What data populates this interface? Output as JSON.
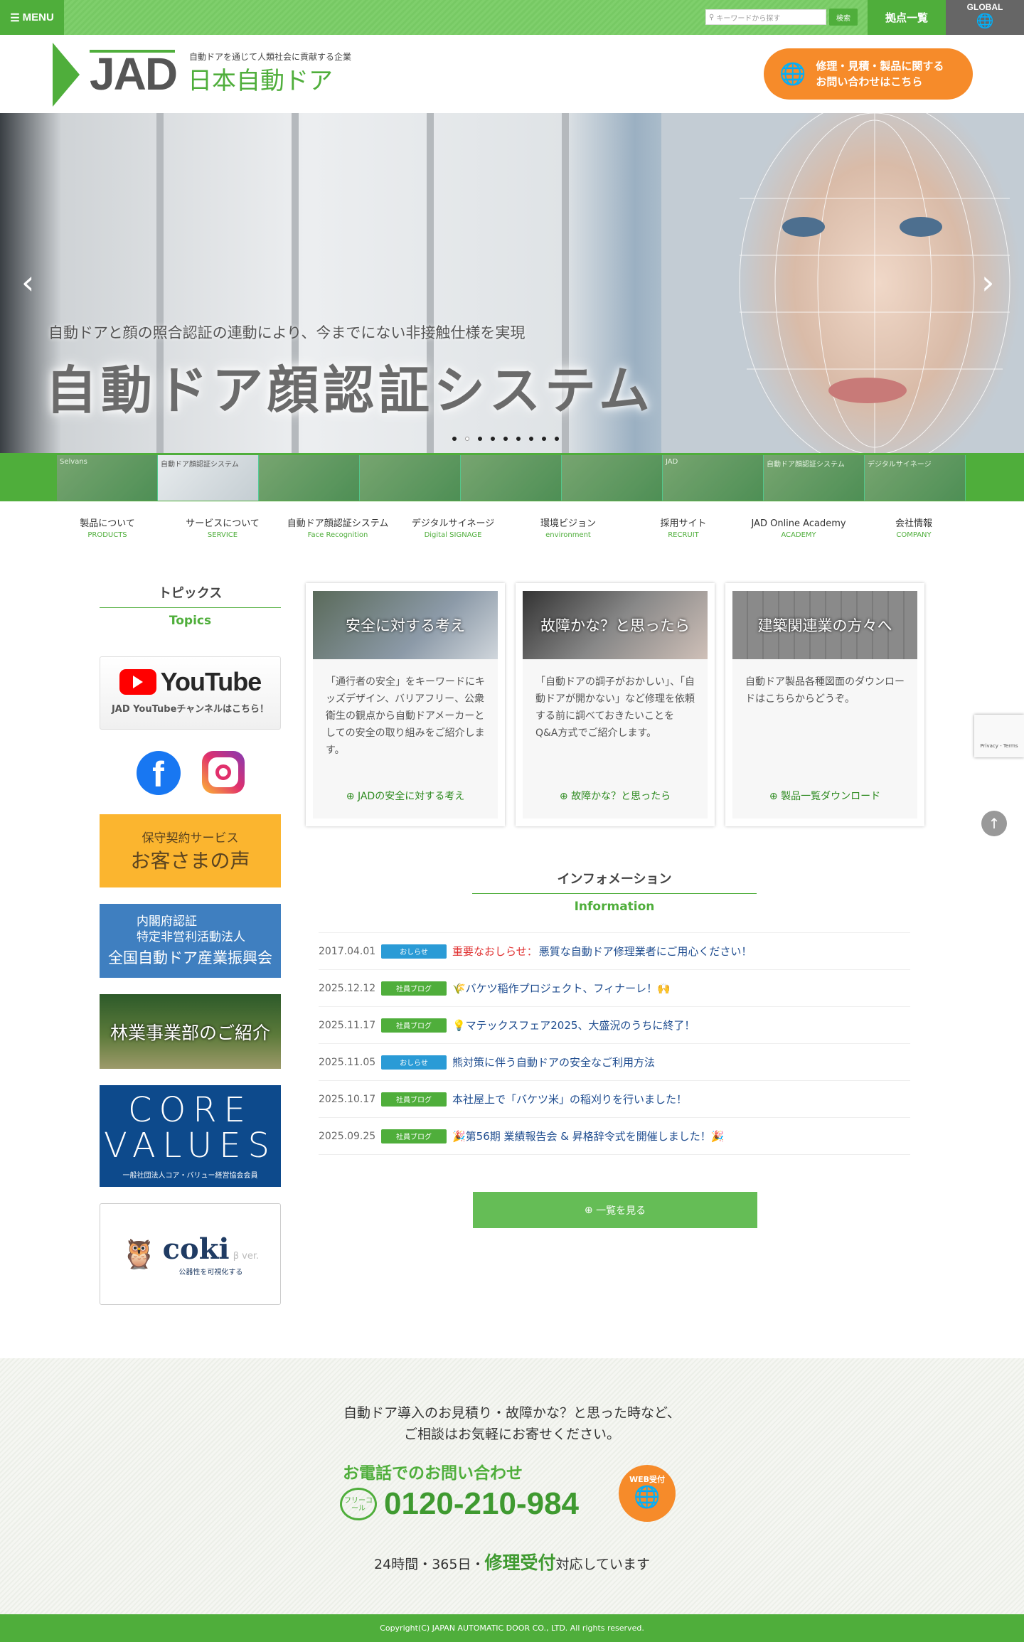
{
  "topbar": {
    "menu": "MENU",
    "search_placeholder": "キーワードから探す",
    "search_button": "検索",
    "bases": "拠点一覧",
    "global": "GLOBAL"
  },
  "header": {
    "logo": "JAD",
    "tagline": "自動ドアを通じて人類社会に貢献する企業",
    "company": "日本自動ドア",
    "cta_line1": "修理・見積・製品に関する",
    "cta_line2": "お問い合わせはこちら"
  },
  "hero": {
    "subtitle": "自動ドアと顔の照合認証の連動により、今までにない非接触仕様を実現",
    "title": "自動ドア顔認証システム",
    "slide_count": 9,
    "active_slide": 2
  },
  "thumbnails": [
    "Selvans",
    "自動ドア顔認証システム",
    "",
    "",
    "",
    "",
    "JAD",
    "自動ドア顔認証システム",
    "デジタルサイネージ"
  ],
  "nav": [
    {
      "ja": "製品について",
      "en": "PRODUCTS"
    },
    {
      "ja": "サービスについて",
      "en": "SERVICE"
    },
    {
      "ja": "自動ドア顔認証システム",
      "en": "Face Recognition"
    },
    {
      "ja": "デジタルサイネージ",
      "en": "Digital SIGNAGE"
    },
    {
      "ja": "環境ビジョン",
      "en": "environment"
    },
    {
      "ja": "採用サイト",
      "en": "RECRUIT"
    },
    {
      "ja": "JAD Online Academy",
      "en": "ACADEMY"
    },
    {
      "ja": "会社情報",
      "en": "COMPANY"
    }
  ],
  "topics": {
    "title": "トピックス",
    "subtitle": "Topics",
    "youtube": {
      "logo": "YouTube",
      "caption": "JAD YouTubeチャンネルはこちら！"
    },
    "voice": {
      "small": "保守契約サービス",
      "large": "お客さまの声"
    },
    "jadia": {
      "line1": "内閣府認証",
      "line2": "特定非営利活動法人",
      "line3": "全国自動ドア産業振興会"
    },
    "forestry": "林業事業部のご紹介",
    "core": {
      "line1": "CORE",
      "line2": "VALUES",
      "caption": "一般社団法人コア・バリュー経営協会会員"
    },
    "coki": {
      "logo": "coki",
      "beta": "β ver.",
      "caption": "公器性を可視化する"
    }
  },
  "cards": [
    {
      "title": "安全に対する考え",
      "text": "「通行者の安全」をキーワードにキッズデザイン、バリアフリー、公衆衛生の観点から自動ドアメーカーとしての安全の取り組みをご紹介します。",
      "link": "JADの安全に対する考え"
    },
    {
      "title": "故障かな？と思ったら",
      "text": "「自動ドアの調子がおかしい」、「自動ドアが開かない」など修理を依頼する前に調べておきたいことをQ&A方式でご紹介します。",
      "link": "故障かな？と思ったら"
    },
    {
      "title": "建築関連業の方々へ",
      "text": "自動ドア製品各種図面のダウンロードはこちらからどうぞ。",
      "link": "製品一覧ダウンロード"
    }
  ],
  "info": {
    "title": "インフォメーション",
    "subtitle": "Information",
    "more": "一覧を見る",
    "colors": {
      "notice": "#2a9bd6",
      "blog": "#4fae3b"
    },
    "rows": [
      {
        "date": "2017.04.01",
        "cat": "おしらせ",
        "type": "notice",
        "prefix": "重要なおしらせ：",
        "title": "悪質な自動ドア修理業者にご用心ください！"
      },
      {
        "date": "2025.12.12",
        "cat": "社員ブログ",
        "type": "blog",
        "prefix": "",
        "title": "🌾バケツ稲作プロジェクト、フィナーレ！🙌"
      },
      {
        "date": "2025.11.17",
        "cat": "社員ブログ",
        "type": "blog",
        "prefix": "",
        "title": "💡マテックスフェア2025、大盛況のうちに終了！"
      },
      {
        "date": "2025.11.05",
        "cat": "おしらせ",
        "type": "notice",
        "prefix": "",
        "title": "熊対策に伴う自動ドアの安全なご利用方法"
      },
      {
        "date": "2025.10.17",
        "cat": "社員ブログ",
        "type": "blog",
        "prefix": "",
        "title": "本社屋上で「バケツ米」の稲刈りを行いました！"
      },
      {
        "date": "2025.09.25",
        "cat": "社員ブログ",
        "type": "blog",
        "prefix": "",
        "title": "🎉第56期 業績報告会 & 昇格辞令式を開催しました！🎉"
      }
    ]
  },
  "contact": {
    "line1": "自動ドア導入のお見積り・故障かな？と思った時など、",
    "line2": "ご相談はお気軽にお寄せください。",
    "phone_label": "お電話でのお問い合わせ",
    "freecall": "フリーコール",
    "phone": "0120-210-984",
    "web": "WEB受付",
    "hours_a": "24時間・365日・",
    "hours_b": "修理受付",
    "hours_c": "対応しています"
  },
  "footer": {
    "copyright": "Copyright(C) JAPAN AUTOMATIC DOOR CO., LTD. All rights reserved."
  },
  "recaptcha": "Privacy - Terms"
}
